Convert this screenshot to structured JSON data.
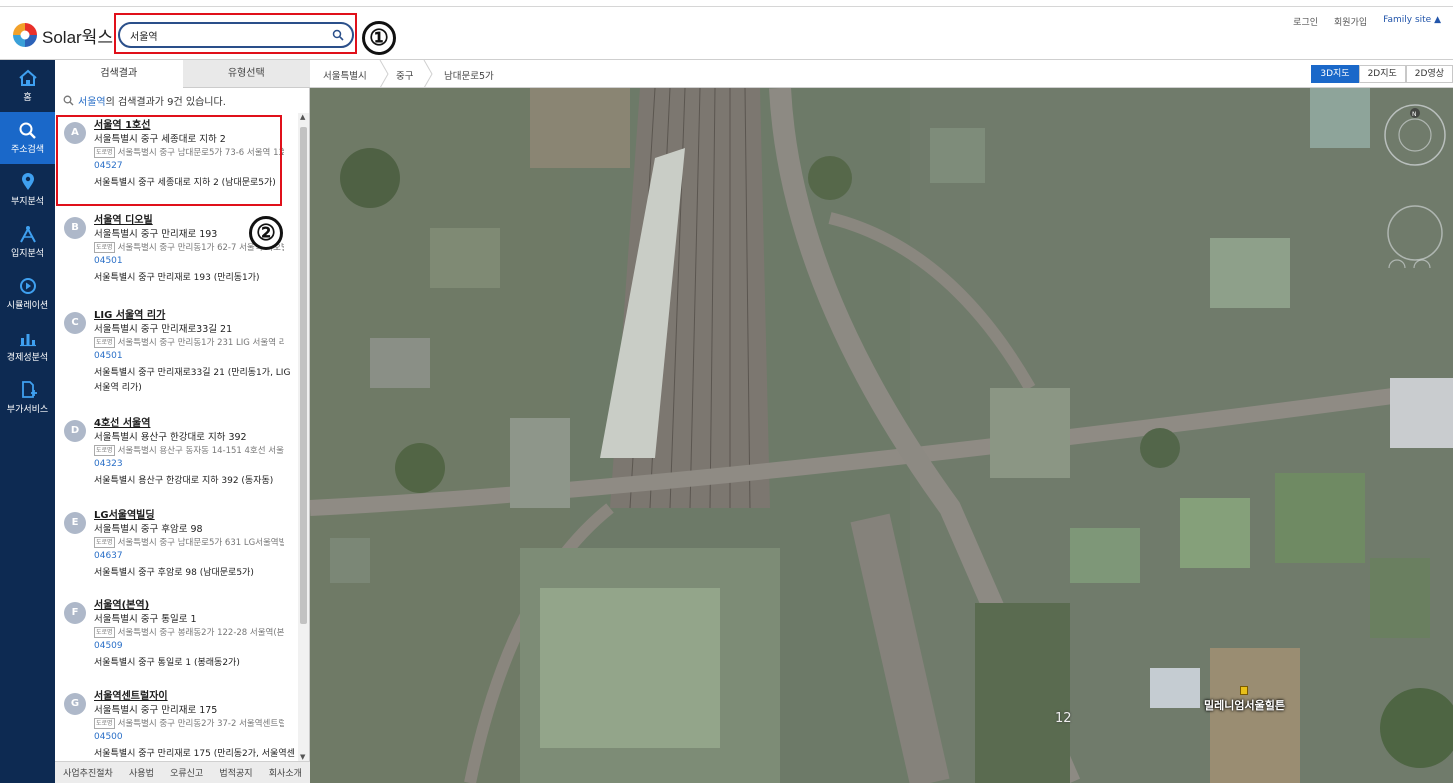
{
  "app": {
    "logo_text": "Solar웍스"
  },
  "search": {
    "value": "서울역"
  },
  "annotations": {
    "one": "①",
    "two": "②"
  },
  "top_links": {
    "login": "로그인",
    "signup": "회원가입",
    "family": "Family site ▲"
  },
  "nav": [
    {
      "label": "홈",
      "icon": "home-icon"
    },
    {
      "label": "주소검색",
      "icon": "search-icon",
      "active": true
    },
    {
      "label": "부지분석",
      "icon": "map-pin-icon"
    },
    {
      "label": "입지분석",
      "icon": "compass-drawing-icon"
    },
    {
      "label": "시뮬레이션",
      "icon": "play-circle-icon"
    },
    {
      "label": "경제성분석",
      "icon": "bar-chart-icon"
    },
    {
      "label": "부가서비스",
      "icon": "document-add-icon"
    }
  ],
  "tabs": {
    "results": "검색결과",
    "types": "유형선택"
  },
  "summary": {
    "keyword": "서울역",
    "suffix": "의 검색결과가 9건 있습니다."
  },
  "results": [
    {
      "letter": "A",
      "name": "서울역 1호선",
      "addr1": "서울특별시 중구 세종대로 지하 2",
      "tag": "도로명",
      "addr2": "서울특별시 중구 남대문로5가 73-6 서울역 1호선",
      "zip": "04527",
      "addr3": "서울특별시 중구 세종대로 지하 2 (남대문로5가)"
    },
    {
      "letter": "B",
      "name": "서울역 디오빌",
      "addr1": "서울특별시 중구 만리재로 193",
      "tag": "도로명",
      "addr2": "서울특별시 중구 만리동1가 62-7 서울역 디오빌",
      "zip": "04501",
      "addr3": "서울특별시 중구 만리재로 193 (만리동1가)"
    },
    {
      "letter": "C",
      "name": "LIG 서울역 리가",
      "addr1": "서울특별시 중구 만리재로33길 21",
      "tag": "도로명",
      "addr2": "서울특별시 중구 만리동1가 231 LIG 서울역 리가",
      "zip": "04501",
      "addr3": "서울특별시 중구 만리재로33길 21 (만리동1가, LIG 서울역 리가)"
    },
    {
      "letter": "D",
      "name": "4호선 서울역",
      "addr1": "서울특별시 용산구 한강대로 지하 392",
      "tag": "도로명",
      "addr2": "서울특별시 용산구 동자동 14-151 4호선 서울역",
      "zip": "04323",
      "addr3": "서울특별시 용산구 한강대로 지하 392 (동자동)"
    },
    {
      "letter": "E",
      "name": "LG서울역빌딩",
      "addr1": "서울특별시 중구 후암로 98",
      "tag": "도로명",
      "addr2": "서울특별시 중구 남대문로5가 631 LG서울역빌딩",
      "zip": "04637",
      "addr3": "서울특별시 중구 후암로 98 (남대문로5가)"
    },
    {
      "letter": "F",
      "name": "서울역(본역)",
      "addr1": "서울특별시 중구 통일로 1",
      "tag": "도로명",
      "addr2": "서울특별시 중구 봉래동2가 122-28 서울역(본역)",
      "zip": "04509",
      "addr3": "서울특별시 중구 통일로 1 (봉래동2가)"
    },
    {
      "letter": "G",
      "name": "서울역센트럴자이",
      "addr1": "서울특별시 중구 만리재로 175",
      "tag": "도로명",
      "addr2": "서울특별시 중구 만리동2가 37-2 서울역센트럴자이",
      "zip": "04500",
      "addr3": "서울특별시 중구 만리재로 175 (만리동2가, 서울역센"
    }
  ],
  "footer": [
    "사업추진절차",
    "사용법",
    "오류신고",
    "법적공지",
    "회사소개"
  ],
  "breadcrumb": [
    "서울특별시",
    "중구",
    "남대문로5가"
  ],
  "map_modes": [
    "3D지도",
    "2D지도",
    "2D영상"
  ],
  "map": {
    "poi_label": "밀레니엄서울힐튼",
    "zoom_level": "12"
  }
}
